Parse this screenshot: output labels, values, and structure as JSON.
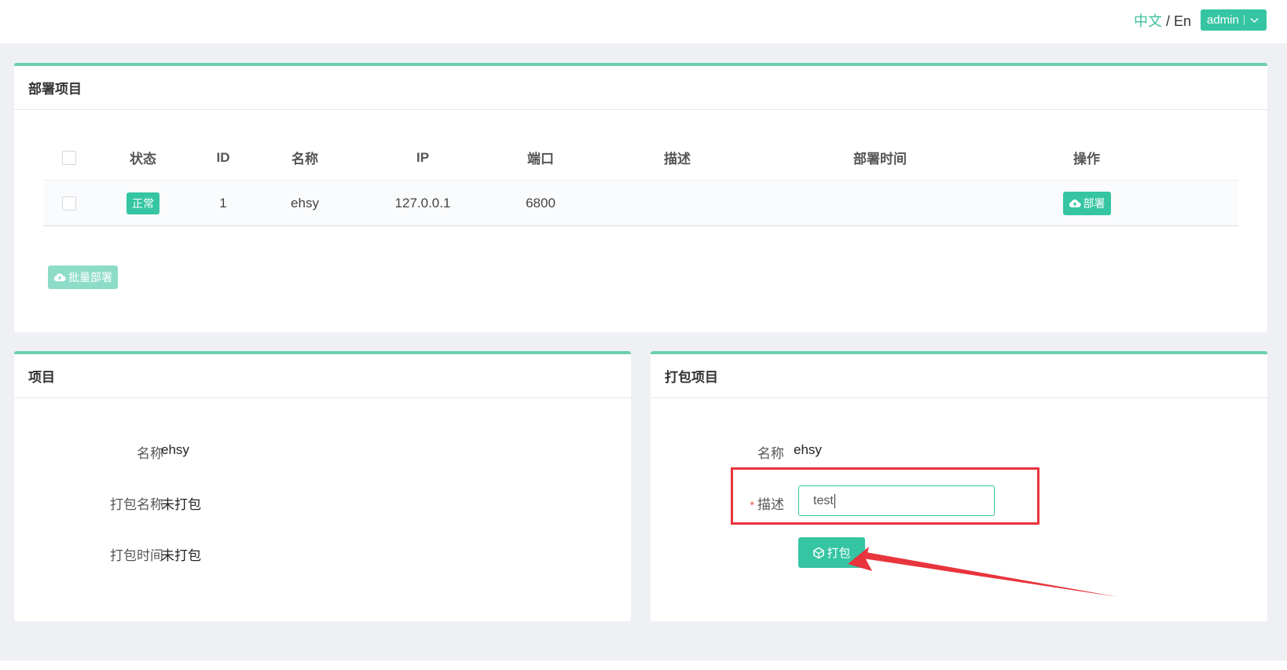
{
  "header": {
    "lang_zh": "中文",
    "lang_sep": " / ",
    "lang_en": "En",
    "user": "admin"
  },
  "deploy_card": {
    "title": "部署项目",
    "columns": [
      "状态",
      "ID",
      "名称",
      "IP",
      "端口",
      "描述",
      "部署时间",
      "操作"
    ],
    "rows": [
      {
        "status": "正常",
        "id": "1",
        "name": "ehsy",
        "ip": "127.0.0.1",
        "port": "6800",
        "desc": "",
        "deploy_time": "",
        "action": "部署"
      }
    ],
    "batch_label": "批量部署"
  },
  "project_card": {
    "title": "项目",
    "fields": [
      {
        "label": "名称",
        "value": "ehsy"
      },
      {
        "label": "打包名称",
        "value": "未打包"
      },
      {
        "label": "打包时间",
        "value": "未打包"
      }
    ]
  },
  "package_card": {
    "title": "打包项目",
    "name_label": "名称",
    "name_value": "ehsy",
    "required_mark": "*",
    "desc_label": "描述",
    "desc_value": "test",
    "pack_label": "打包"
  },
  "colors": {
    "accent": "#35c5a2",
    "card_top_border": "#6cd0ac",
    "annotation_red": "#e8343c"
  },
  "icons": {
    "dropdown": "chevron-down-icon",
    "deploy": "cloud-upload-icon",
    "pack": "package-icon"
  }
}
